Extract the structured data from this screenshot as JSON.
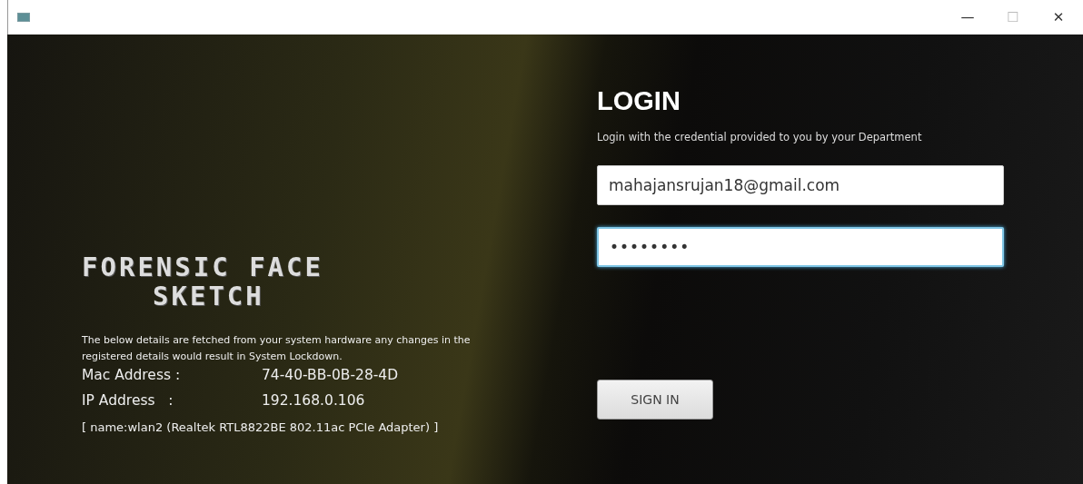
{
  "window": {
    "controls": [
      "—",
      "☐",
      "✕"
    ]
  },
  "branding": {
    "title_lines": [
      "FORENSIC FACE",
      "SKETCH"
    ]
  },
  "system_info": {
    "notice": "The below details are fetched from your system hardware any changes in the registered details would result in System Lockdown.",
    "rows": [
      {
        "label": "Mac Address :",
        "value": "74-40-BB-0B-28-4D"
      },
      {
        "label": "IP Address   :",
        "value": "192.168.0.106"
      }
    ],
    "adapter": "[ name:wlan2 (Realtek RTL8822BE 802.11ac PCIe Adapter) ]"
  },
  "login": {
    "heading": "LOGIN",
    "subtitle": "Login with the credential provided to you by your Department",
    "fields": [
      {
        "kind": "email",
        "value": "mahajansrujan18@gmail.com",
        "focused": false
      },
      {
        "kind": "password",
        "value": "••••••••",
        "focused": true
      }
    ],
    "button": "SIGN IN"
  }
}
